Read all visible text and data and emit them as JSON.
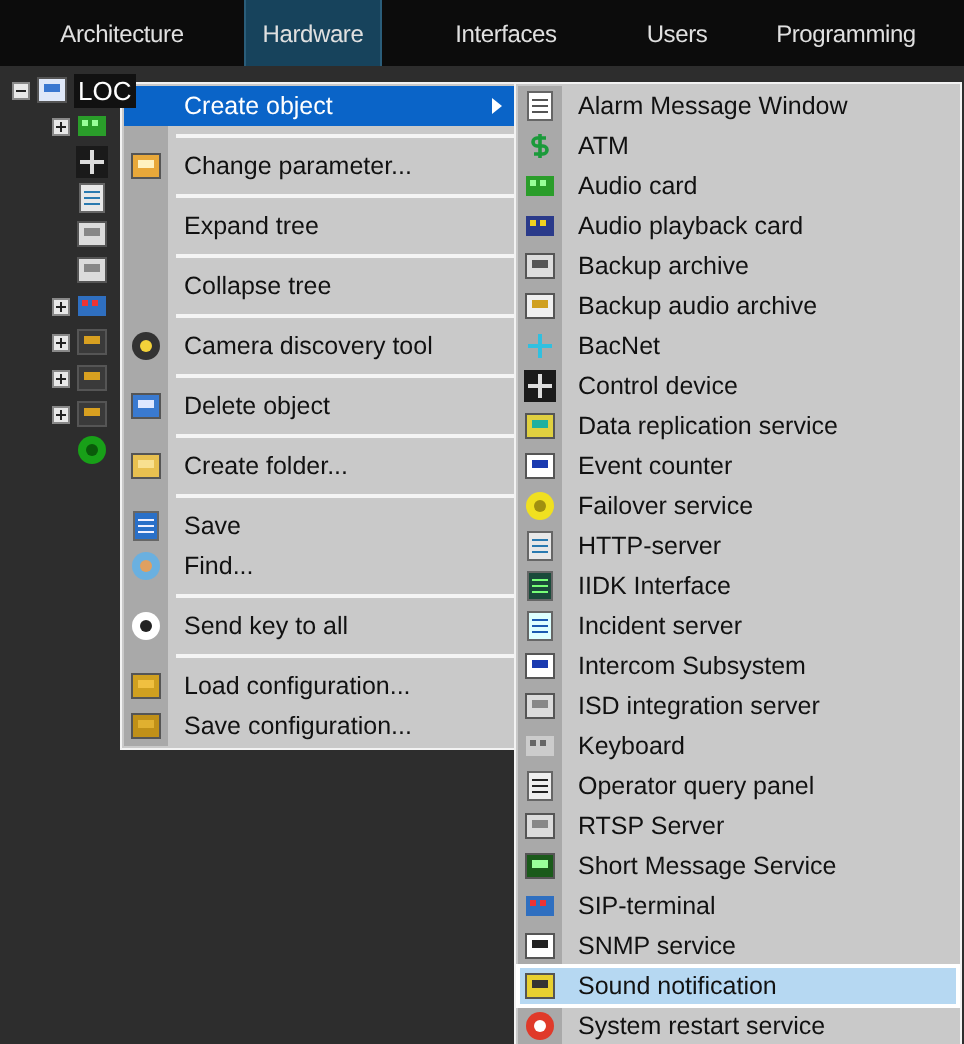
{
  "tabs": [
    {
      "label": "Architecture",
      "selected": false
    },
    {
      "label": "Hardware",
      "selected": true
    },
    {
      "label": "Interfaces",
      "selected": false
    },
    {
      "label": "Users",
      "selected": false
    },
    {
      "label": "Programming",
      "selected": false
    }
  ],
  "tree": {
    "root": {
      "label": "LOC",
      "expanded": true,
      "children": [
        {
          "kind": "group",
          "expanded": false
        },
        {
          "kind": "leaf"
        },
        {
          "kind": "leaf"
        },
        {
          "kind": "leaf"
        },
        {
          "kind": "leaf"
        },
        {
          "kind": "group",
          "expanded": false
        },
        {
          "kind": "group",
          "expanded": false
        },
        {
          "kind": "group",
          "expanded": false
        },
        {
          "kind": "group",
          "expanded": false
        },
        {
          "kind": "leaf"
        }
      ]
    }
  },
  "context_menu": {
    "groups": [
      [
        {
          "label": "Create object",
          "selected": true,
          "submenu": true
        }
      ],
      [
        {
          "label": "Change parameter...",
          "selected": false
        }
      ],
      [
        {
          "label": "Expand tree",
          "selected": false
        }
      ],
      [
        {
          "label": "Collapse tree",
          "selected": false
        }
      ],
      [
        {
          "label": "Camera discovery tool",
          "selected": false
        }
      ],
      [
        {
          "label": "Delete object",
          "selected": false
        }
      ],
      [
        {
          "label": "Create folder...",
          "selected": false
        }
      ],
      [
        {
          "label": "Save",
          "selected": false
        },
        {
          "label": "Find...",
          "selected": false
        }
      ],
      [
        {
          "label": "Send key to all",
          "selected": false
        }
      ],
      [
        {
          "label": "Load configuration...",
          "selected": false
        },
        {
          "label": "Save configuration...",
          "selected": false
        }
      ]
    ]
  },
  "submenu": {
    "items": [
      {
        "label": "Alarm Message Window",
        "selected": false
      },
      {
        "label": "ATM",
        "selected": false
      },
      {
        "label": "Audio card",
        "selected": false
      },
      {
        "label": "Audio playback card",
        "selected": false
      },
      {
        "label": "Backup archive",
        "selected": false
      },
      {
        "label": "Backup audio archive",
        "selected": false
      },
      {
        "label": "BacNet",
        "selected": false
      },
      {
        "label": "Control device",
        "selected": false
      },
      {
        "label": "Data replication service",
        "selected": false
      },
      {
        "label": "Event counter",
        "selected": false
      },
      {
        "label": "Failover service",
        "selected": false
      },
      {
        "label": "HTTP-server",
        "selected": false
      },
      {
        "label": "IIDK Interface",
        "selected": false
      },
      {
        "label": "Incident server",
        "selected": false
      },
      {
        "label": "Intercom Subsystem",
        "selected": false
      },
      {
        "label": "ISD integration server",
        "selected": false
      },
      {
        "label": "Keyboard",
        "selected": false
      },
      {
        "label": "Operator query panel",
        "selected": false
      },
      {
        "label": "RTSP Server",
        "selected": false
      },
      {
        "label": "Short Message Service",
        "selected": false
      },
      {
        "label": "SIP-terminal",
        "selected": false
      },
      {
        "label": "SNMP service",
        "selected": false
      },
      {
        "label": "Sound notification",
        "selected": true
      },
      {
        "label": "System restart service",
        "selected": false
      }
    ]
  }
}
